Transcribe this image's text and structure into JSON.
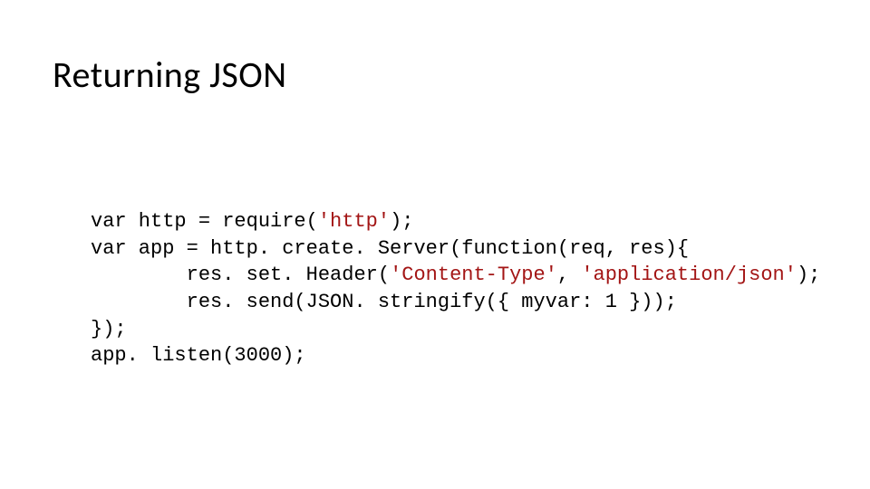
{
  "slide": {
    "title": "Returning JSON",
    "code": {
      "line1_a": "var http = require(",
      "line1_str": "'http'",
      "line1_b": ");",
      "line2": "var app = http. create. Server(function(req, res){",
      "line3_a": "        res. set. Header(",
      "line3_str1": "'Content-Type'",
      "line3_b": ", ",
      "line3_str2": "'application/json'",
      "line3_c": ");",
      "line4": "        res. send(JSON. stringify({ myvar: 1 }));",
      "line5": "});",
      "line6": "app. listen(3000);"
    }
  }
}
